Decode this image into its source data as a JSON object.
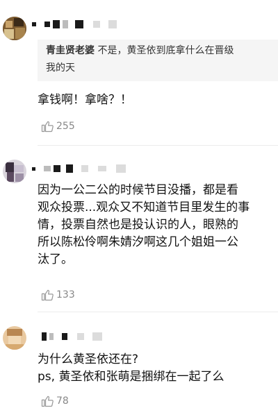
{
  "comments": [
    {
      "quote_name": "青圭贤老婆",
      "quote_text_1": " 不是，黄圣依到底拿什么在晋级",
      "quote_text_2": "我的天",
      "text_lines": [
        "拿钱啊！拿啥？！"
      ],
      "likes": "255"
    },
    {
      "text_lines": [
        "因为一公二公的时候节目没播，都是看",
        "观众投票...观众又不知道节目里发生的事",
        "情，投票自然也是投认识的人，眼熟的",
        "所以陈松伶啊朱婧汐啊这几个姐姐一公",
        "汰了。"
      ],
      "likes": "133"
    },
    {
      "text_lines": [
        "为什么黄圣依还在?",
        "ps, 黄圣依和张萌是捆绑在一起了么"
      ],
      "likes": "78"
    }
  ],
  "icons": {
    "like": "thumbs-up-icon",
    "avatar": "avatar"
  }
}
